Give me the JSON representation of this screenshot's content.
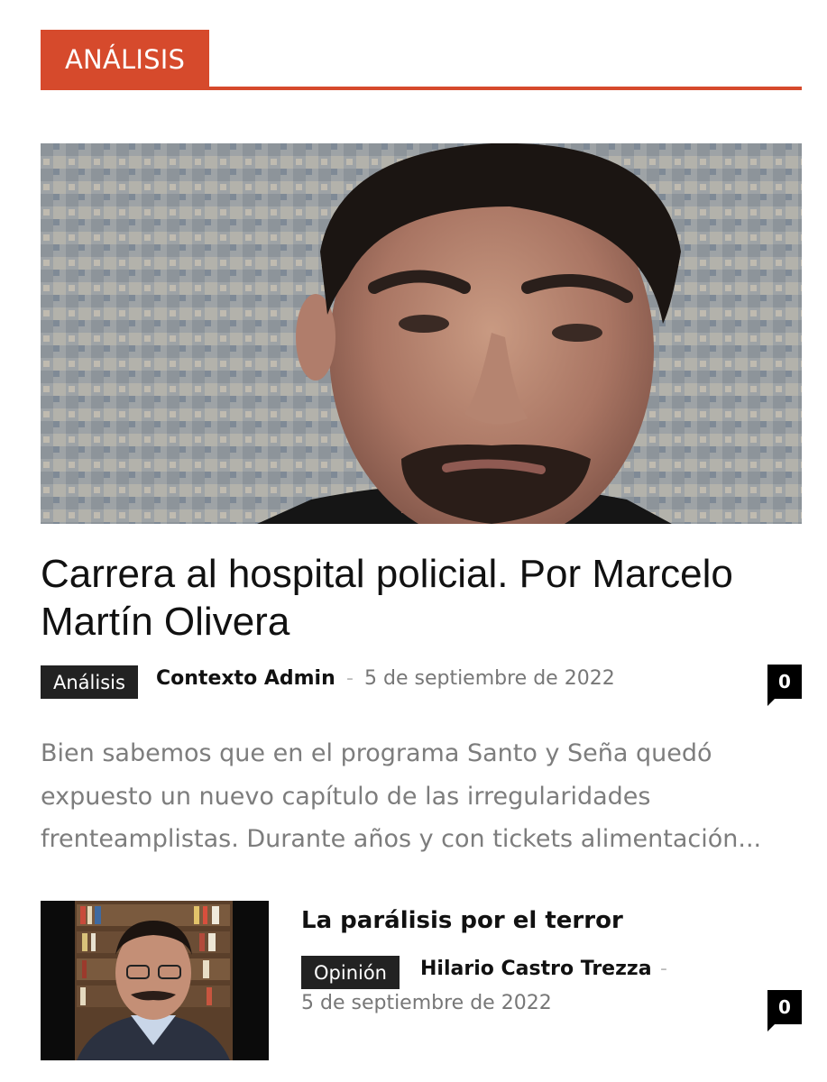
{
  "section": {
    "label": "ANÁLISIS"
  },
  "colors": {
    "accent": "#d64a2c",
    "badge_bg": "#222222",
    "comment_bg": "#000000",
    "excerpt_text": "#7d7d7d",
    "date_text": "#777777"
  },
  "featured": {
    "image_icon": "portrait-photo",
    "title": "Carrera al hospital policial. Por Marcelo Martín Olivera",
    "category": "Análisis",
    "author": "Contexto Admin",
    "separator": "-",
    "date": "5 de septiembre de 2022",
    "comments": "0",
    "excerpt": "Bien sabemos que en el programa Santo y Seña quedó expuesto un nuevo capítulo de las irregularidades frenteamplistas. Durante años y con tickets alimentación..."
  },
  "second": {
    "image_icon": "portrait-photo",
    "title": "La parálisis por el terror",
    "category": "Opinión",
    "author": "Hilario Castro Trezza",
    "separator": "-",
    "date": "5 de septiembre de 2022",
    "comments": "0"
  }
}
